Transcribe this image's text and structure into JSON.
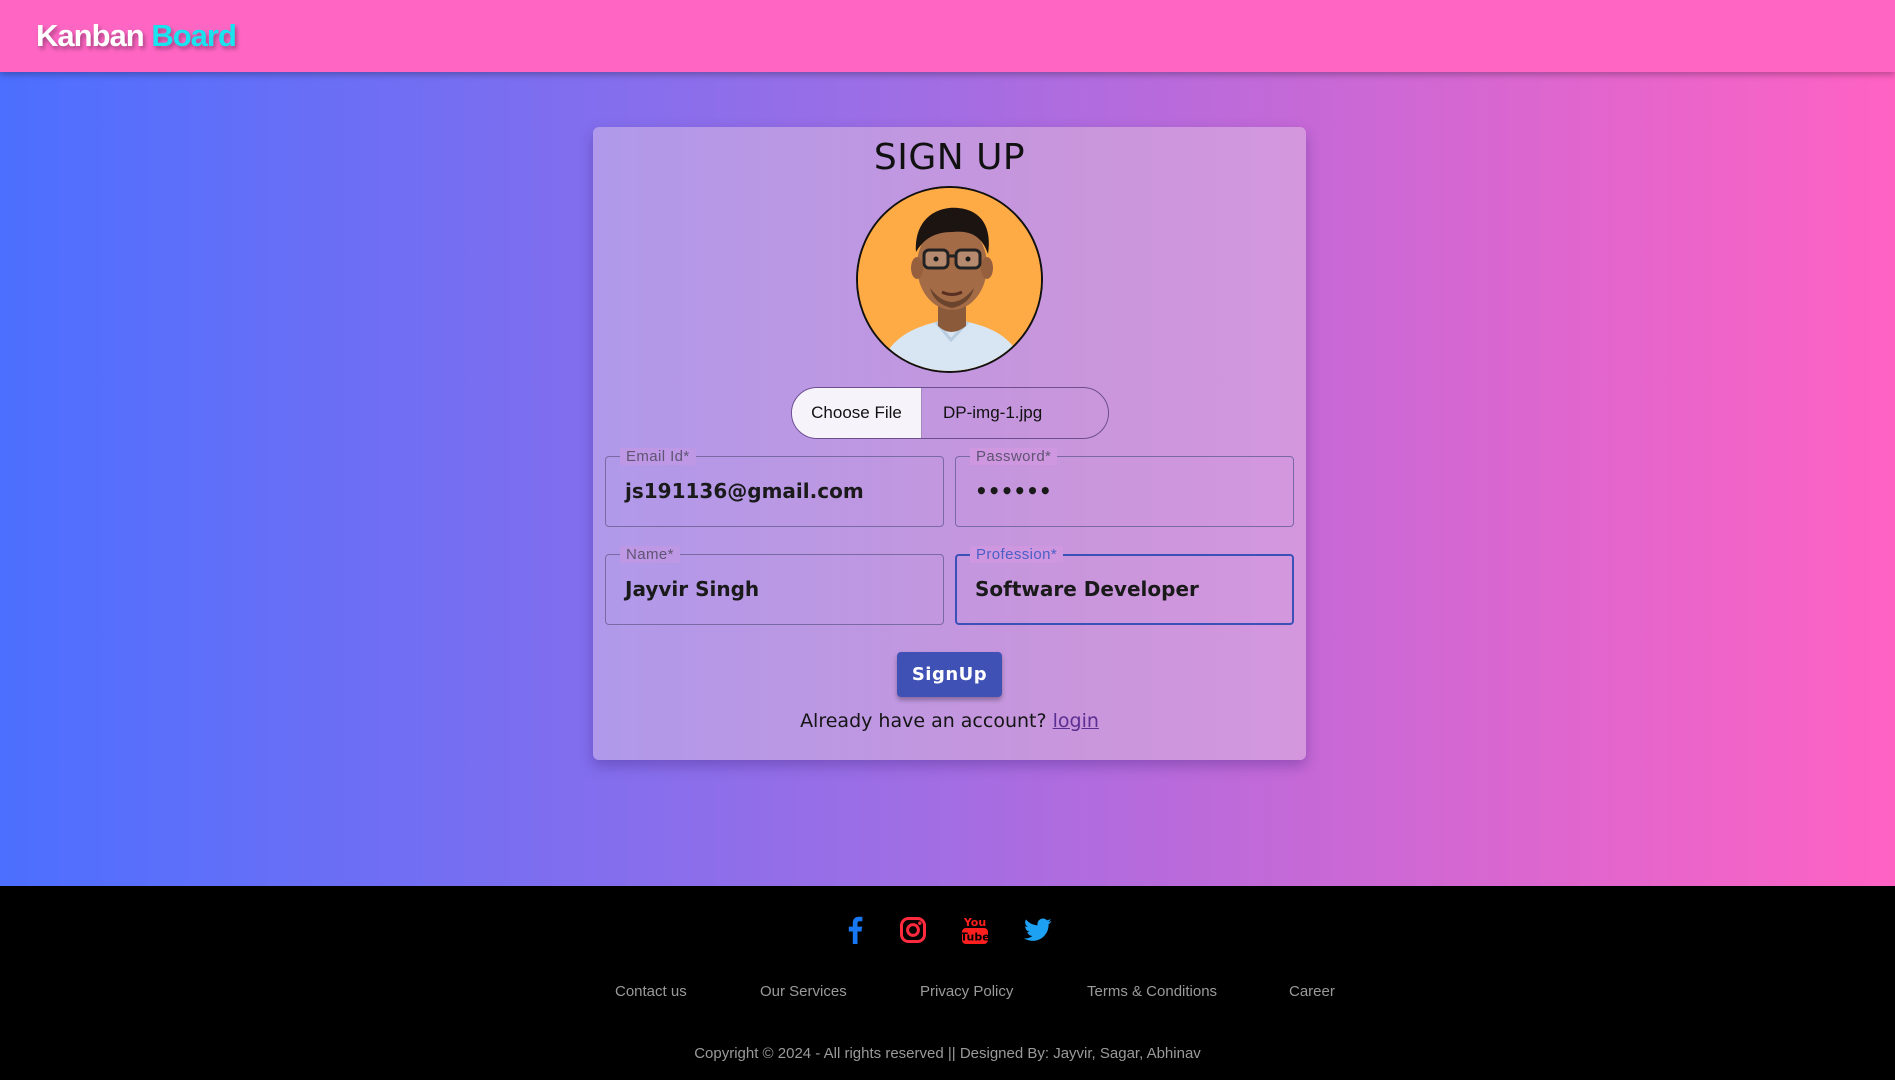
{
  "header": {
    "brand_part1": "Kanban",
    "brand_part2": "Board"
  },
  "signup": {
    "title": "SIGN UP",
    "file_button": "Choose File",
    "file_name": "DP-img-1.jpg",
    "email": {
      "label": "Email Id*",
      "value": "js191136@gmail.com"
    },
    "password": {
      "label": "Password*",
      "value": "••••••"
    },
    "name": {
      "label": "Name*",
      "value": "Jayvir Singh"
    },
    "profession": {
      "label": "Profession*",
      "value": "Software Developer"
    },
    "submit_label": "SignUp",
    "account_text": "Already have an account?",
    "login_link": "login"
  },
  "footer": {
    "social_icons": [
      "facebook-icon",
      "instagram-icon",
      "youtube-icon",
      "twitter-icon"
    ],
    "links": [
      "Contact us",
      "Our Services",
      "Privacy Policy",
      "Terms & Conditions",
      "Career"
    ],
    "copyright": "Copyright © 2024 - All rights reserved || Designed By: Jayvir, Sagar, Abhinav"
  },
  "colors": {
    "header_bg": "#ff66c4",
    "brand_accent": "#19e3ef",
    "button_bg": "#3f51b5",
    "focus_border": "#3c51b8",
    "footer_bg": "#000000"
  }
}
